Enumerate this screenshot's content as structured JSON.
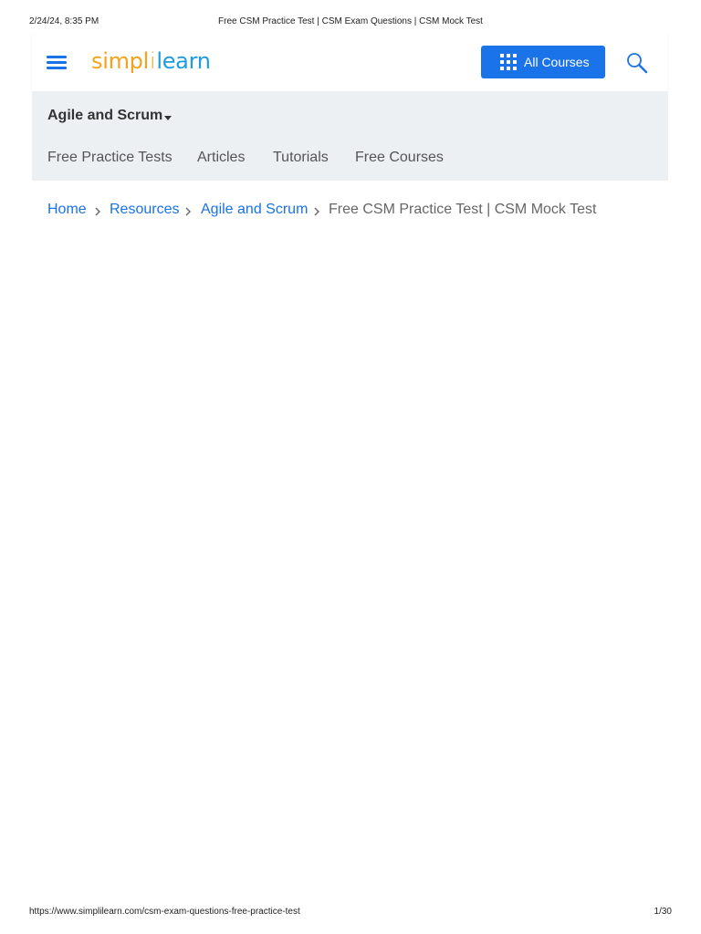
{
  "print_header": {
    "datetime": "2/24/24, 8:35 PM",
    "title": "Free CSM Practice Test | CSM Exam Questions | CSM Mock Test"
  },
  "header": {
    "logo": {
      "part1": "simpl",
      "separator": "i",
      "part2": "learn"
    },
    "all_courses_label": "All Courses",
    "icons": {
      "menu": "hamburger-menu-icon",
      "grid": "grid-icon",
      "search": "search-icon"
    }
  },
  "subnav": {
    "category": "Agile and Scrum",
    "tabs": [
      "Free Practice Tests",
      "Articles",
      "Tutorials",
      "Free Courses"
    ]
  },
  "breadcrumb": {
    "items": [
      "Home",
      "Resources",
      "Agile and Scrum"
    ],
    "current": "Free CSM Practice Test | CSM Mock Test"
  },
  "print_footer": {
    "url": "https://www.simplilearn.com/csm-exam-questions-free-practice-test",
    "page": "1/30"
  },
  "colors": {
    "accent": "#1a73e8",
    "logo_orange": "#f7a21b",
    "logo_blue": "#1f9bde",
    "subnav_bg": "#ecf0f3"
  }
}
